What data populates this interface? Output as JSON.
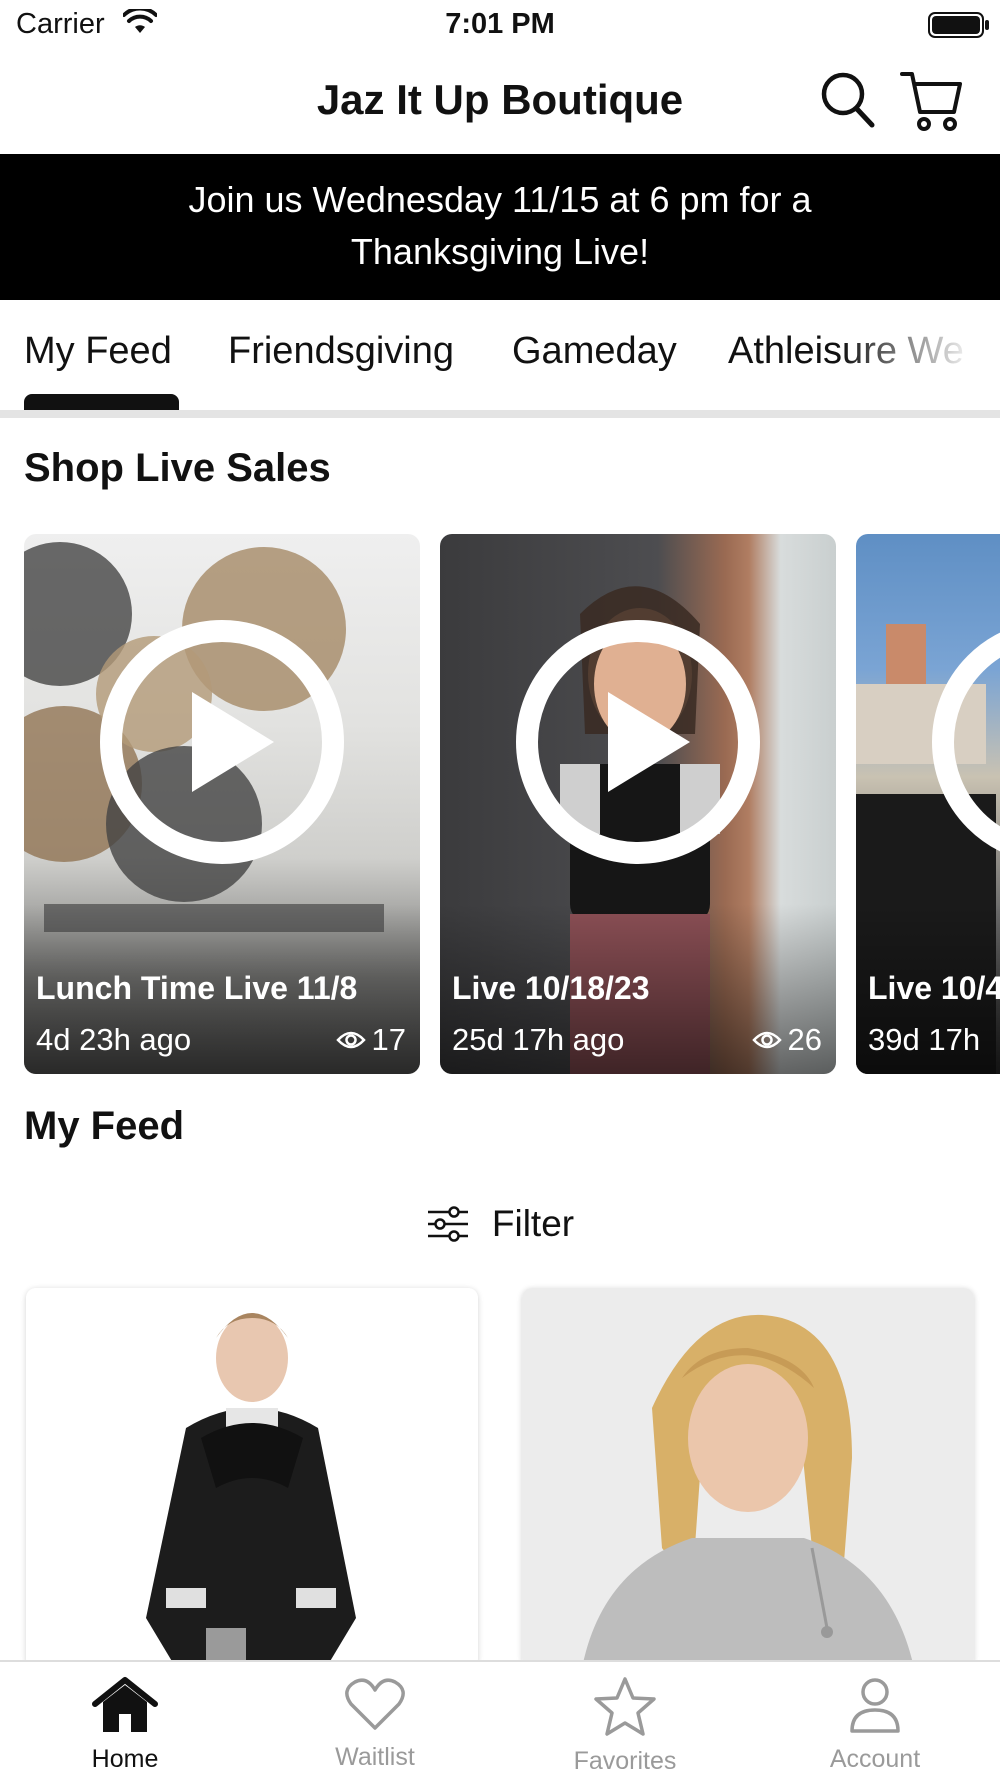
{
  "status_bar": {
    "carrier": "Carrier",
    "time": "7:01 PM"
  },
  "header": {
    "title": "Jaz It Up Boutique"
  },
  "banner": {
    "line1": "Join us Wednesday 11/15 at 6 pm for a",
    "line2": "Thanksgiving Live!"
  },
  "tabs": [
    {
      "label": "My Feed",
      "active": true
    },
    {
      "label": "Friendsgiving"
    },
    {
      "label": "Gameday"
    },
    {
      "label": "Athleisure We"
    }
  ],
  "live_section": {
    "title": "Shop Live Sales",
    "cards": [
      {
        "name": "Lunch Time Live 11/8",
        "ago": "4d 23h ago",
        "views": "17"
      },
      {
        "name": "Live 10/18/23",
        "ago": "25d 17h ago",
        "views": "26"
      },
      {
        "name": "Live 10/4",
        "ago": "39d 17h",
        "views": ""
      }
    ]
  },
  "feed": {
    "title": "My Feed",
    "filter_label": "Filter"
  },
  "bottom_nav": [
    {
      "label": "Home",
      "icon": "home-icon",
      "active": true
    },
    {
      "label": "Waitlist",
      "icon": "heart-icon"
    },
    {
      "label": "Favorites",
      "icon": "star-icon"
    },
    {
      "label": "Account",
      "icon": "person-icon"
    }
  ],
  "colors": {
    "banner_bg": "#000000",
    "accent": "#111111",
    "inactive": "#9a9a9a"
  }
}
